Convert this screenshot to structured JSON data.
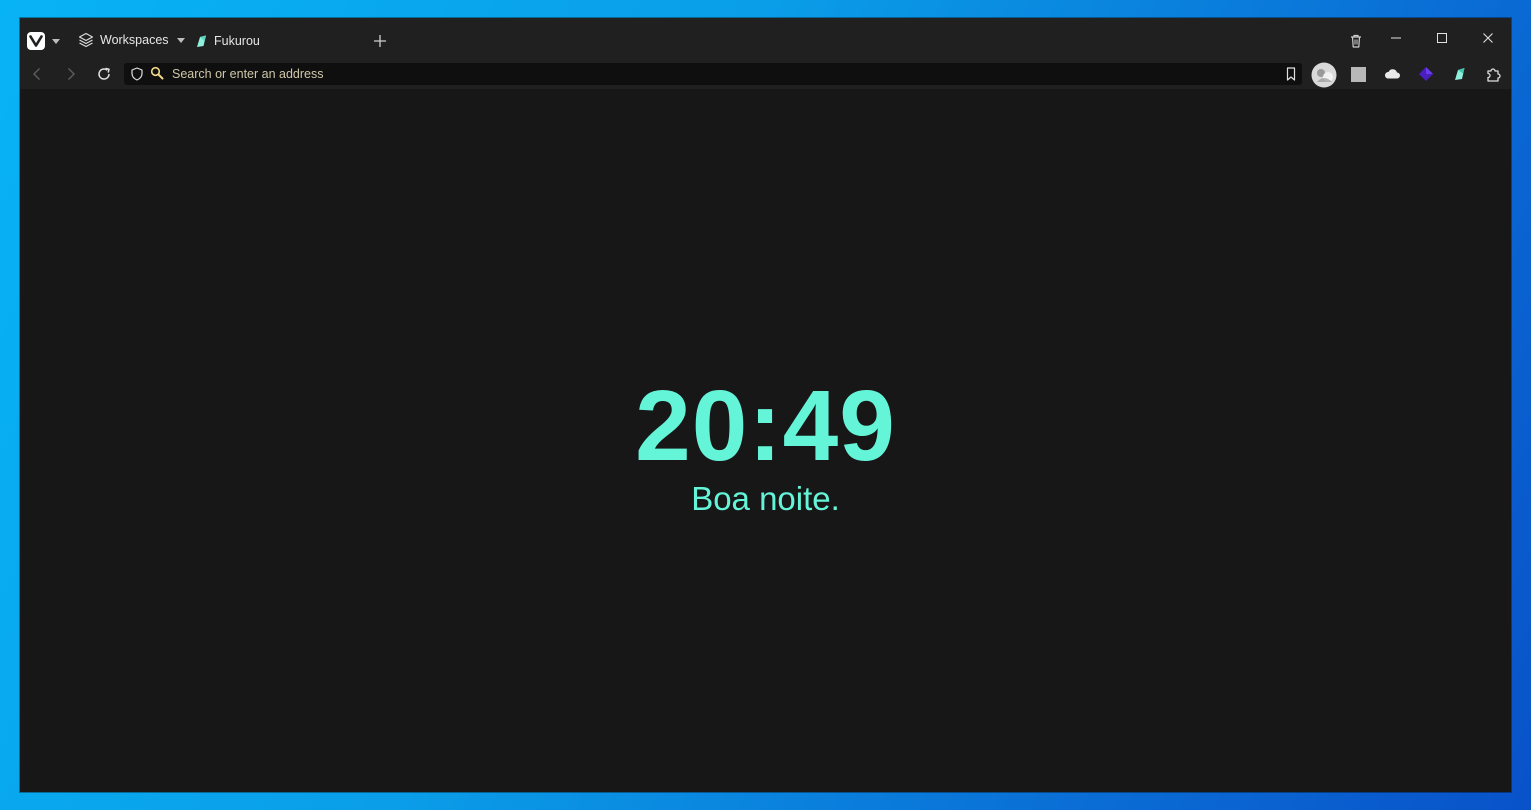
{
  "titlebar": {
    "menu_icon": "vivaldi-logo-icon",
    "workspaces_label": "Workspaces",
    "tab": {
      "title": "Fukurou",
      "icon": "fukurou-tab-icon"
    },
    "new_tab_icon": "plus-icon",
    "trash_icon": "trash-icon",
    "window_controls": [
      "minimize-icon",
      "maximize-icon",
      "close-icon"
    ]
  },
  "toolbar": {
    "address_placeholder": "Search or enter an address",
    "extensions": [
      "avatar-extension",
      "gray-square-extension",
      "cloud-extension",
      "purple-diamond-extension",
      "fukurou-extension",
      "puzzle-icon"
    ]
  },
  "main": {
    "clock": "20:49",
    "greeting": "Boa noite."
  },
  "colors": {
    "accent": "#64f5d9",
    "background": "#171717",
    "chrome": "#202020",
    "address_text": "#cfc7a8"
  }
}
